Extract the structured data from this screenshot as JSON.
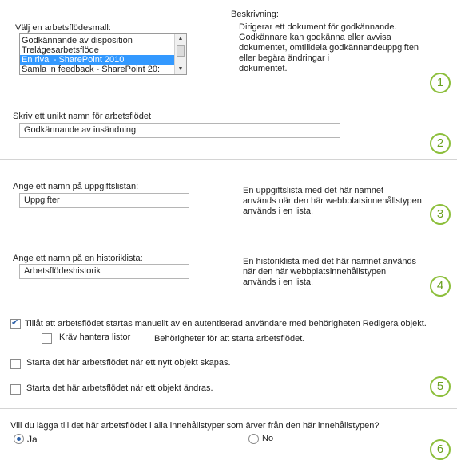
{
  "section1": {
    "template_label": "Välj en arbetsflödesmall:",
    "templates": [
      "Godkännande av disposition",
      "Trelägesarbetsflöde",
      "En rival -        SharePoint 2010",
      "Samla in feedback - SharePoint 20:"
    ],
    "selected_index": 2,
    "description_label": "Beskrivning:",
    "description_lines": [
      "Dirigerar ett dokument för godkännande.",
      "Godkännare kan godkänna eller avvisa",
      "dokumentet, omtilldela godkännandeuppgiften",
      "eller begära ändringar i",
      "dokumentet."
    ],
    "step": "1"
  },
  "section2": {
    "label": "Skriv ett unikt namn för arbetsflödet",
    "value": "Godkännande av insändning",
    "step": "2"
  },
  "section3": {
    "label": "Ange ett namn på uppgiftslistan:",
    "value": "Uppgifter",
    "description_lines": [
      "En uppgiftslista med det här namnet",
      "används när den här webbplatsinnehållstypen",
      "används i en lista."
    ],
    "step": "3"
  },
  "section4": {
    "label": "Ange ett namn på en historiklista:",
    "value": "Arbetsflödeshistorik",
    "description_lines": [
      "En historiklista med det här namnet används",
      "när den här webbplatsinnehållstypen",
      "används i en lista."
    ],
    "step": "4"
  },
  "section5": {
    "manual_start_label": "Tillåt att arbetsflödet startas manuellt av en autentiserad användare med behörigheten Redigera objekt.",
    "manual_start_checked": true,
    "require_manage_lists_label": "Kräv hantera listor",
    "require_manage_lists_checked": false,
    "permissions_note": "Behörigheter för att starta arbetsflödet.",
    "on_create_label": "Starta det här arbetsflödet när ett nytt objekt skapas.",
    "on_create_checked": false,
    "on_change_label": "Starta det här arbetsflödet när ett objekt ändras.",
    "on_change_checked": false,
    "step": "5"
  },
  "section6": {
    "question": "Vill du lägga till det här arbetsflödet i alla innehållstyper som ärver från den här innehållstypen?",
    "yes_label": "Ja",
    "no_label": "No",
    "selected": "yes",
    "step": "6"
  }
}
